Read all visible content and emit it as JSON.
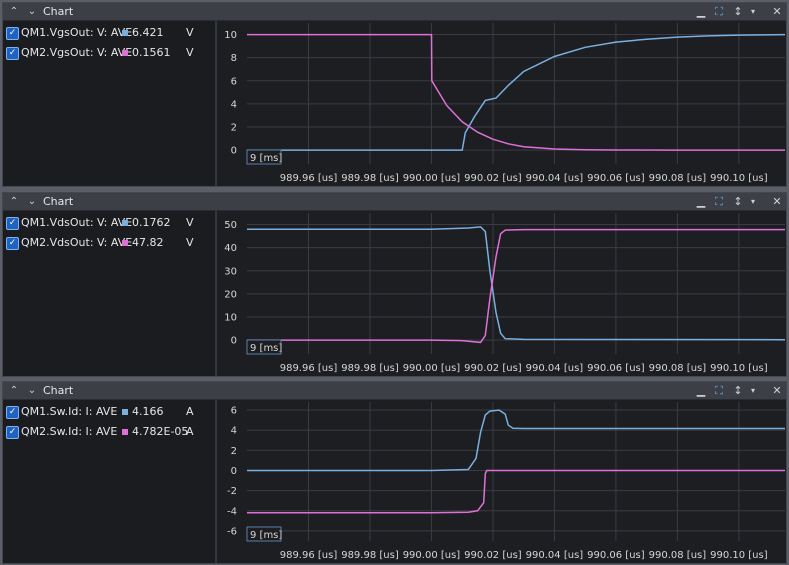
{
  "window": {
    "up_icon": "chevron-up-icon",
    "down_icon": "chevron-down-icon",
    "minimize_icon": "minimize-icon",
    "fit_icon": "fit-all-icon",
    "fit_y_icon": "fit-y-icon",
    "menu_icon": "dropdown-arrow-icon",
    "close_icon": "close-icon"
  },
  "colors": {
    "series_blue": "#7ab0e0",
    "series_magenta": "#e070d8",
    "grid": "#3a3c42",
    "background": "#1d1e22"
  },
  "panels": [
    {
      "title": "Chart",
      "legend": [
        {
          "name": "QM1.VgsOut: V: AVE",
          "value": "6.421",
          "unit": "V",
          "color": "#7ab0e0"
        },
        {
          "name": "QM2.VgsOut: V: AVE",
          "value": "0.1561",
          "unit": "V",
          "color": "#e070d8"
        }
      ],
      "axis_badge": "9 [ms]"
    },
    {
      "title": "Chart",
      "legend": [
        {
          "name": "QM1.VdsOut: V: AVE",
          "value": "0.1762",
          "unit": "V",
          "color": "#7ab0e0"
        },
        {
          "name": "QM2.VdsOut: V: AVE",
          "value": "47.82",
          "unit": "V",
          "color": "#e070d8"
        }
      ],
      "axis_badge": "9 [ms]"
    },
    {
      "title": "Chart",
      "legend": [
        {
          "name": "QM1.Sw.Id: I: AVE",
          "value": "4.166",
          "unit": "A",
          "color": "#7ab0e0"
        },
        {
          "name": "QM2.Sw.Id: I: AVE",
          "value": "4.782E-05",
          "unit": "A",
          "color": "#e070d8"
        }
      ],
      "axis_badge": "9 [ms]"
    }
  ],
  "chart_data": [
    {
      "type": "line",
      "x_tick_labels": [
        "989.96 [us]",
        "989.98 [us]",
        "990.00 [us]",
        "990.02 [us]",
        "990.04 [us]",
        "990.06 [us]",
        "990.08 [us]",
        "990.10 [us]"
      ],
      "x_ticks": [
        989.96,
        989.98,
        990.0,
        990.02,
        990.04,
        990.06,
        990.08,
        990.1
      ],
      "xlim": [
        989.94,
        990.115
      ],
      "y_ticks": [
        0,
        2,
        4,
        6,
        8,
        10
      ],
      "ylim": [
        -1.2,
        11
      ],
      "series": [
        {
          "name": "QM1.VgsOut: V: AVE",
          "color": "#7ab0e0",
          "x": [
            989.94,
            990.0,
            990.01,
            990.011,
            990.014,
            990.0175,
            990.021,
            990.025,
            990.03,
            990.04,
            990.05,
            990.06,
            990.07,
            990.08,
            990.09,
            990.1,
            990.115
          ],
          "y": [
            0,
            0,
            0,
            1.5,
            2.9,
            4.3,
            4.5,
            5.6,
            6.8,
            8.1,
            8.9,
            9.35,
            9.6,
            9.78,
            9.88,
            9.95,
            10
          ]
        },
        {
          "name": "QM2.VgsOut: V: AVE",
          "color": "#e070d8",
          "x": [
            989.94,
            990.0,
            990.0001,
            990.005,
            990.01,
            990.015,
            990.02,
            990.025,
            990.03,
            990.04,
            990.05,
            990.06,
            990.08,
            990.115
          ],
          "y": [
            10,
            10,
            6.0,
            3.85,
            2.45,
            1.55,
            0.95,
            0.55,
            0.3,
            0.1,
            0.03,
            0.01,
            0,
            0
          ]
        }
      ]
    },
    {
      "type": "line",
      "x_tick_labels": [
        "989.96 [us]",
        "989.98 [us]",
        "990.00 [us]",
        "990.02 [us]",
        "990.04 [us]",
        "990.06 [us]",
        "990.08 [us]",
        "990.10 [us]"
      ],
      "x_ticks": [
        989.96,
        989.98,
        990.0,
        990.02,
        990.04,
        990.06,
        990.08,
        990.1
      ],
      "xlim": [
        989.94,
        990.115
      ],
      "y_ticks": [
        0,
        10,
        20,
        30,
        40,
        50
      ],
      "ylim": [
        -6,
        55
      ],
      "series": [
        {
          "name": "QM1.VdsOut: V: AVE",
          "color": "#7ab0e0",
          "x": [
            989.94,
            990.0,
            990.012,
            990.016,
            990.0175,
            990.019,
            990.021,
            990.0225,
            990.024,
            990.03,
            990.115
          ],
          "y": [
            48,
            48,
            48.5,
            49,
            47,
            30,
            12,
            3,
            0.6,
            0.3,
            0.2
          ]
        },
        {
          "name": "QM2.VdsOut: V: AVE",
          "color": "#e070d8",
          "x": [
            989.94,
            990.0,
            990.01,
            990.016,
            990.0175,
            990.019,
            990.021,
            990.0225,
            990.024,
            990.03,
            990.115
          ],
          "y": [
            0,
            0,
            -0.2,
            -1,
            2,
            18,
            36,
            46,
            47.6,
            47.8,
            47.8
          ]
        }
      ]
    },
    {
      "type": "line",
      "x_tick_labels": [
        "989.96 [us]",
        "989.98 [us]",
        "990.00 [us]",
        "990.02 [us]",
        "990.04 [us]",
        "990.06 [us]",
        "990.08 [us]",
        "990.10 [us]"
      ],
      "x_ticks": [
        989.96,
        989.98,
        990.0,
        990.02,
        990.04,
        990.06,
        990.08,
        990.1
      ],
      "xlim": [
        989.94,
        990.115
      ],
      "y_ticks": [
        -6,
        -4,
        -2,
        0,
        2,
        4,
        6
      ],
      "ylim": [
        -7,
        6.8
      ],
      "series": [
        {
          "name": "QM1.Sw.Id: I: AVE",
          "color": "#7ab0e0",
          "x": [
            989.94,
            990.0,
            990.012,
            990.0145,
            990.016,
            990.0175,
            990.019,
            990.022,
            990.024,
            990.025,
            990.0265,
            990.03,
            990.115
          ],
          "y": [
            0,
            0,
            0.1,
            1.2,
            3.8,
            5.5,
            5.9,
            6.0,
            5.6,
            4.5,
            4.2,
            4.17,
            4.166
          ]
        },
        {
          "name": "QM2.Sw.Id: I: AVE",
          "color": "#e070d8",
          "x": [
            989.94,
            990.0,
            990.012,
            990.015,
            990.017,
            990.0175,
            990.018,
            990.03,
            990.115
          ],
          "y": [
            -4.2,
            -4.2,
            -4.15,
            -4.0,
            -3.2,
            -0.3,
            0,
            0,
            0
          ]
        }
      ]
    }
  ]
}
